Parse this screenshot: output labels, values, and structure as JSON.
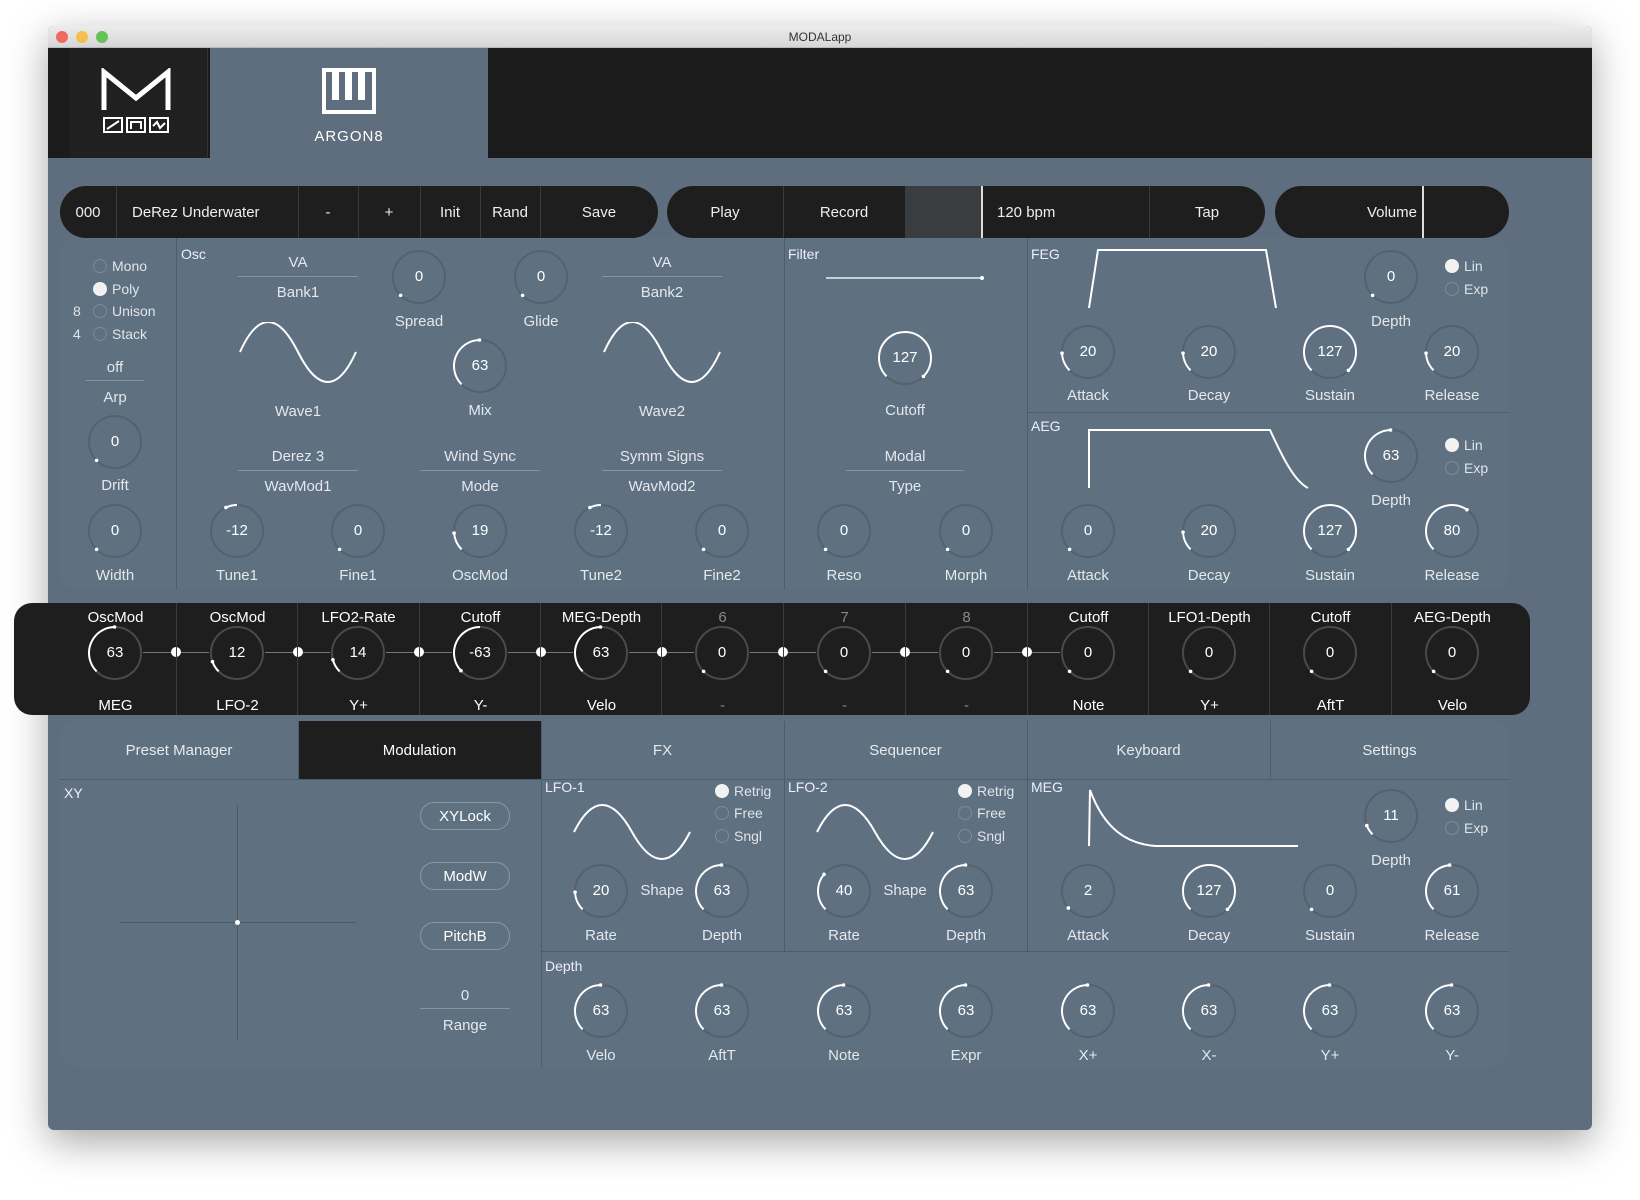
{
  "window": {
    "title": "MODALapp"
  },
  "header": {
    "instrument": "ARGON8"
  },
  "transport": {
    "preset_number": "000",
    "preset_name": "DeRez Underwater",
    "minus": "-",
    "plus": "+",
    "init": "Init",
    "rand": "Rand",
    "save": "Save",
    "play": "Play",
    "record": "Record",
    "tempo": "120 bpm",
    "tap": "Tap",
    "volume": "Volume"
  },
  "voice": {
    "modes": [
      "Mono",
      "Poly",
      "Unison",
      "Stack"
    ],
    "selected_mode": "Poly",
    "unison_count": "8",
    "stack_count": "4",
    "arp_value": "off",
    "arp_label": "Arp",
    "drift": {
      "label": "Drift",
      "value": "0"
    },
    "width": {
      "label": "Width",
      "value": "0"
    }
  },
  "osc": {
    "header": "Osc",
    "osc1": {
      "type": "VA",
      "bank": "Bank1",
      "wave_label": "Wave1",
      "wavmod_value": "Derez 3",
      "wavmod_label": "WavMod1"
    },
    "osc2": {
      "type": "VA",
      "bank": "Bank2",
      "wave_label": "Wave2",
      "wavmod_value": "Symm Signs",
      "wavmod_label": "WavMod2"
    },
    "spread": {
      "label": "Spread",
      "value": "0"
    },
    "glide": {
      "label": "Glide",
      "value": "0"
    },
    "mix": {
      "label": "Mix",
      "value": "63"
    },
    "mode_value": "Wind Sync",
    "mode_label": "Mode",
    "tune1": {
      "label": "Tune1",
      "value": "-12"
    },
    "fine1": {
      "label": "Fine1",
      "value": "0"
    },
    "oscmod": {
      "label": "OscMod",
      "value": "19"
    },
    "tune2": {
      "label": "Tune2",
      "value": "-12"
    },
    "fine2": {
      "label": "Fine2",
      "value": "0"
    }
  },
  "filter": {
    "header": "Filter",
    "cutoff": {
      "label": "Cutoff",
      "value": "127"
    },
    "type_value": "Modal",
    "type_label": "Type",
    "reso": {
      "label": "Reso",
      "value": "0"
    },
    "morph": {
      "label": "Morph",
      "value": "0"
    }
  },
  "feg": {
    "header": "FEG",
    "depth": {
      "label": "Depth",
      "value": "0"
    },
    "lin": "Lin",
    "exp": "Exp",
    "attack": {
      "label": "Attack",
      "value": "20"
    },
    "decay": {
      "label": "Decay",
      "value": "20"
    },
    "sustain": {
      "label": "Sustain",
      "value": "127"
    },
    "release": {
      "label": "Release",
      "value": "20"
    }
  },
  "aeg": {
    "header": "AEG",
    "depth": {
      "label": "Depth",
      "value": "63"
    },
    "lin": "Lin",
    "exp": "Exp",
    "attack": {
      "label": "Attack",
      "value": "0"
    },
    "decay": {
      "label": "Decay",
      "value": "20"
    },
    "sustain": {
      "label": "Sustain",
      "value": "127"
    },
    "release": {
      "label": "Release",
      "value": "80"
    }
  },
  "modslots": [
    {
      "dest": "OscMod",
      "value": "63",
      "src": "MEG",
      "dim": false
    },
    {
      "dest": "OscMod",
      "value": "12",
      "src": "LFO-2",
      "dim": false
    },
    {
      "dest": "LFO2-Rate",
      "value": "14",
      "src": "Y+",
      "dim": false
    },
    {
      "dest": "Cutoff",
      "value": "-63",
      "src": "Y-",
      "dim": false
    },
    {
      "dest": "MEG-Depth",
      "value": "63",
      "src": "Velo",
      "dim": false
    },
    {
      "dest": "6",
      "value": "0",
      "src": "-",
      "dim": true
    },
    {
      "dest": "7",
      "value": "0",
      "src": "-",
      "dim": true
    },
    {
      "dest": "8",
      "value": "0",
      "src": "-",
      "dim": true
    },
    {
      "dest": "Cutoff",
      "value": "0",
      "src": "Note",
      "dim": false
    },
    {
      "dest": "LFO1-Depth",
      "value": "0",
      "src": "Y+",
      "dim": false
    },
    {
      "dest": "Cutoff",
      "value": "0",
      "src": "AftT",
      "dim": false
    },
    {
      "dest": "AEG-Depth",
      "value": "0",
      "src": "Velo",
      "dim": false
    }
  ],
  "tabs": [
    "Preset Manager",
    "Modulation",
    "FX",
    "Sequencer",
    "Keyboard",
    "Settings"
  ],
  "active_tab": "Modulation",
  "xy": {
    "header": "XY",
    "xylock": "XYLock",
    "modw": "ModW",
    "pitchb": "PitchB",
    "range_value": "0",
    "range_label": "Range"
  },
  "lfo1": {
    "header": "LFO-1",
    "retrig": "Retrig",
    "free": "Free",
    "sngl": "Sngl",
    "shape": "Shape",
    "rate": {
      "label": "Rate",
      "value": "20"
    },
    "depth": {
      "label": "Depth",
      "value": "63"
    }
  },
  "lfo2": {
    "header": "LFO-2",
    "retrig": "Retrig",
    "free": "Free",
    "sngl": "Sngl",
    "shape": "Shape",
    "rate": {
      "label": "Rate",
      "value": "40"
    },
    "depth": {
      "label": "Depth",
      "value": "63"
    }
  },
  "meg": {
    "header": "MEG",
    "lin": "Lin",
    "exp": "Exp",
    "depth": {
      "label": "Depth",
      "value": "11"
    },
    "attack": {
      "label": "Attack",
      "value": "2"
    },
    "decay": {
      "label": "Decay",
      "value": "127"
    },
    "sustain": {
      "label": "Sustain",
      "value": "0"
    },
    "release": {
      "label": "Release",
      "value": "61"
    }
  },
  "depth": {
    "header": "Depth",
    "items": [
      {
        "label": "Velo",
        "value": "63"
      },
      {
        "label": "AftT",
        "value": "63"
      },
      {
        "label": "Note",
        "value": "63"
      },
      {
        "label": "Expr",
        "value": "63"
      },
      {
        "label": "X+",
        "value": "63"
      },
      {
        "label": "X-",
        "value": "63"
      },
      {
        "label": "Y+",
        "value": "63"
      },
      {
        "label": "Y-",
        "value": "63"
      }
    ]
  },
  "colors": {
    "panel": "#5f7081",
    "dark": "#1e1e1e",
    "accent": "#ffffff",
    "traffic": [
      "#ee6a5f",
      "#f5be4f",
      "#61c454"
    ]
  }
}
